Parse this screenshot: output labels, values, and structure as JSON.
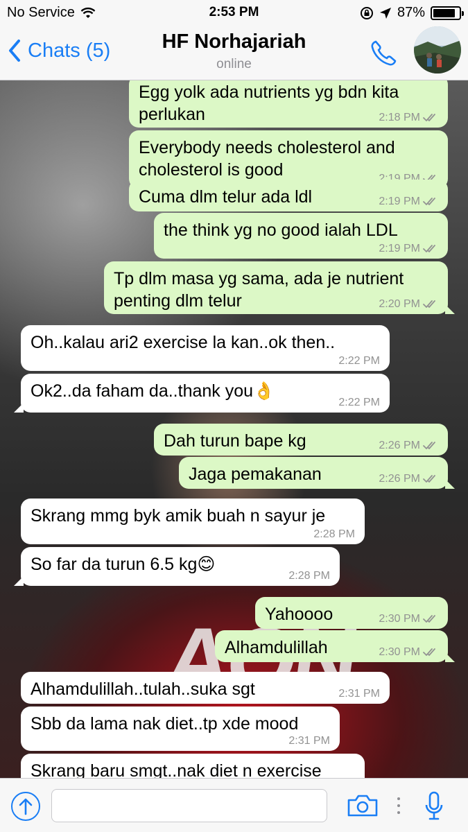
{
  "status_bar": {
    "carrier": "No Service",
    "time": "2:53 PM",
    "battery": "87%",
    "battery_level": 0.87
  },
  "header": {
    "back_label": "Chats (5)",
    "contact_name": "HF Norhajariah",
    "presence": "online"
  },
  "messages": [
    {
      "text": "Egg yolk ada nutrients yg bdn kita perlukan",
      "time": "2:18 PM",
      "direction": "outgoing",
      "ticks": "read"
    },
    {
      "text": "Everybody needs cholesterol and cholesterol is good",
      "time": "2:19 PM",
      "direction": "outgoing",
      "ticks": "read"
    },
    {
      "text": "Cuma dlm telur ada ldl",
      "time": "2:19 PM",
      "direction": "outgoing",
      "ticks": "read"
    },
    {
      "text": "the think yg no good ialah LDL",
      "time": "2:19 PM",
      "direction": "outgoing",
      "ticks": "read"
    },
    {
      "text": "Tp dlm masa yg sama, ada je nutrient penting dlm telur",
      "time": "2:20 PM",
      "direction": "outgoing",
      "ticks": "read"
    },
    {
      "text": "Oh..kalau ari2 exercise la kan..ok then..",
      "time": "2:22 PM",
      "direction": "incoming"
    },
    {
      "text": "Ok2..da faham da..thank you👌",
      "time": "2:22 PM",
      "direction": "incoming"
    },
    {
      "text": "Dah turun bape kg",
      "time": "2:26 PM",
      "direction": "outgoing",
      "ticks": "read"
    },
    {
      "text": "Jaga pemakanan",
      "time": "2:26 PM",
      "direction": "outgoing",
      "ticks": "read"
    },
    {
      "text": "Skrang mmg byk amik buah n sayur je",
      "time": "2:28 PM",
      "direction": "incoming"
    },
    {
      "text": "So far da turun 6.5 kg😊",
      "time": "2:28 PM",
      "direction": "incoming"
    },
    {
      "text": "Yahoooo",
      "time": "2:30 PM",
      "direction": "outgoing",
      "ticks": "read"
    },
    {
      "text": "Alhamdulillah",
      "time": "2:30 PM",
      "direction": "outgoing",
      "ticks": "read"
    },
    {
      "text": "Alhamdulillah..tulah..suka sgt",
      "time": "2:31 PM",
      "direction": "incoming"
    },
    {
      "text": "Sbb da lama nak diet..tp xde mood",
      "time": "2:31 PM",
      "direction": "incoming"
    },
    {
      "text": "Skrang baru smgt..nak diet n exercise",
      "time": "",
      "direction": "incoming"
    }
  ],
  "composer": {
    "value": "",
    "placeholder": ""
  },
  "icons": {
    "back": "chevron-left-icon",
    "call": "phone-icon",
    "attach": "upload-arrow-icon",
    "camera": "camera-icon",
    "mic": "microphone-icon"
  },
  "colors": {
    "accent": "#1a7ef5",
    "outgoing_bubble": "#dcf8c6",
    "incoming_bubble": "#ffffff",
    "read_ticks": "#929292"
  }
}
